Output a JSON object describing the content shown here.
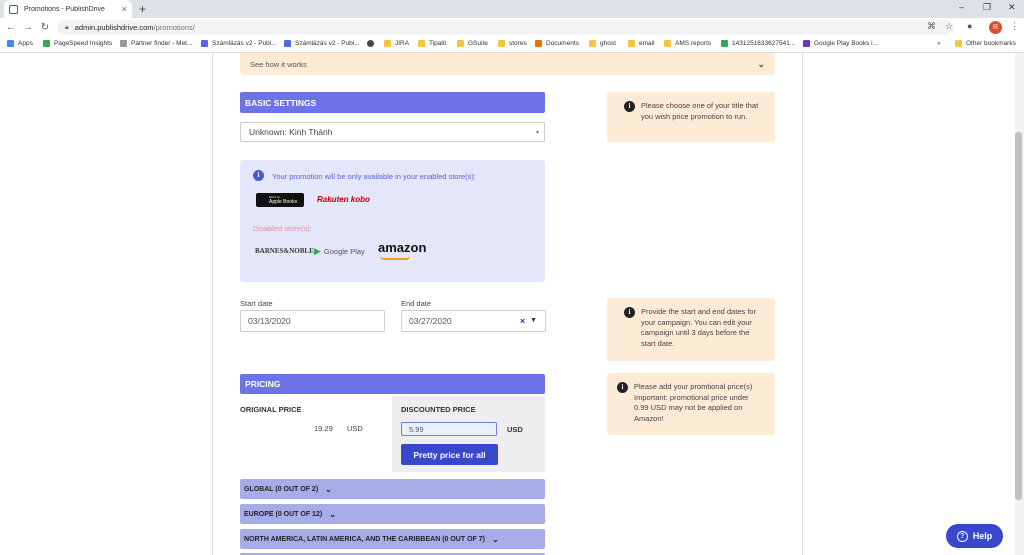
{
  "browser": {
    "tab_title": "Promotions - PublishDrive",
    "url_host": "admin.publishdrive.com",
    "url_path": "/promotions/",
    "avatar_letter": "R",
    "bookmarks": [
      "Apps",
      "PageSpeed Insights",
      "Partner finder - Met...",
      "Számlázás v2 - Publ...",
      "Számlázás v2 - Publ...",
      "JIRA",
      "Tipalti",
      "GSuite",
      "stores",
      "Documents",
      "ghost",
      "email",
      "AMS reports",
      "1431251633627541...",
      "Google Play Books i...",
      "Other bookmarks"
    ]
  },
  "page": {
    "how_it_works": "See how it works",
    "basic_settings": {
      "header": "BASIC SETTINGS",
      "title_select": "Unknown: Kinh Thánh",
      "note": "Please choose one of your title that you wish price promotion to run."
    },
    "stores": {
      "enabled_text": "Your promotion will be only available in your enabled store(s):",
      "enabled": [
        "Apple Books",
        "Rakuten kobo"
      ],
      "apple_small": "Get it on",
      "disabled_label": "Disabled store(s):",
      "disabled": [
        "BARNES&NOBLE",
        "Google Play",
        "amazon"
      ]
    },
    "dates": {
      "start_label": "Start date",
      "start_value": "03/13/2020",
      "end_label": "End date",
      "end_value": "03/27/2020",
      "note": "Provide the start and end dates for your campaign. You can edit your campaign until 3 days before the start date."
    },
    "pricing": {
      "header": "PRICING",
      "original_label": "ORIGINAL PRICE",
      "original_value": "19.29",
      "original_currency": "USD",
      "discounted_label": "DISCOUNTED PRICE",
      "discounted_value": "5.99",
      "discounted_currency": "USD",
      "pretty_button": "Pretty price for all",
      "note": "Please add your promtional price(s) Important: promotional price under 0.99 USD may not be applied on Amazon!"
    },
    "regions": [
      "GLOBAL (0 OUT OF 2)",
      "EUROPE (0 OUT OF 12)",
      "NORTH AMERICA, LATIN AMERICA, AND THE CARIBBEAN (0 OUT OF 7)"
    ],
    "help_button": "Help"
  }
}
